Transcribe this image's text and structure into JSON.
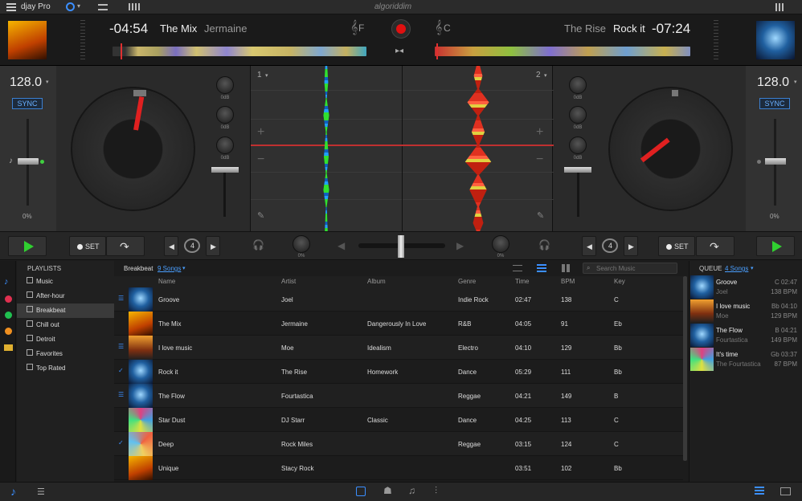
{
  "app": {
    "title": "djay Pro",
    "brand": "algoriddim"
  },
  "deck_left": {
    "time": "-04:54",
    "title": "The Mix",
    "artist": "Jermaine",
    "key": "F",
    "bpm": "128.0",
    "sync": "SYNC",
    "pitch": "0%",
    "num": "1",
    "loop": "4",
    "set": "SET"
  },
  "deck_right": {
    "time": "-07:24",
    "title": "Rock it",
    "artist": "The Rise",
    "key": "C",
    "bpm": "128.0",
    "sync": "SYNC",
    "pitch": "0%",
    "num": "2",
    "loop": "4",
    "set": "SET"
  },
  "eq_labels": {
    "l1": "0dB",
    "l2": "0dB",
    "l3": "0dB",
    "r1": "0dB",
    "r2": "0dB",
    "r3": "0dB",
    "f1": "0%",
    "f2": "0%"
  },
  "sidebar": {
    "header": "PLAYLISTS",
    "items": [
      {
        "label": "Music"
      },
      {
        "label": "After-hour"
      },
      {
        "label": "Breakbeat"
      },
      {
        "label": "Chill out"
      },
      {
        "label": "Detroit"
      },
      {
        "label": "Favorites"
      },
      {
        "label": "Top Rated"
      }
    ]
  },
  "library": {
    "playlist": "Breakbeat",
    "count": "9 Songs",
    "search_placeholder": "Search Music",
    "columns": {
      "name": "Name",
      "artist": "Artist",
      "album": "Album",
      "genre": "Genre",
      "time": "Time",
      "bpm": "BPM",
      "key": "Key"
    },
    "rows": [
      {
        "name": "Groove",
        "artist": "Joel",
        "album": "",
        "genre": "Indie Rock",
        "time": "02:47",
        "bpm": "138",
        "key": "C"
      },
      {
        "name": "The Mix",
        "artist": "Jermaine",
        "album": "Dangerously In Love",
        "genre": "R&B",
        "time": "04:05",
        "bpm": "91",
        "key": "Eb"
      },
      {
        "name": "I love music",
        "artist": "Moe",
        "album": "Idealism",
        "genre": "Electro",
        "time": "04:10",
        "bpm": "129",
        "key": "Bb"
      },
      {
        "name": "Rock it",
        "artist": "The Rise",
        "album": "Homework",
        "genre": "Dance",
        "time": "05:29",
        "bpm": "111",
        "key": "Bb"
      },
      {
        "name": "The Flow",
        "artist": "Fourtastica",
        "album": "",
        "genre": "Reggae",
        "time": "04:21",
        "bpm": "149",
        "key": "B"
      },
      {
        "name": "Star Dust",
        "artist": "DJ Starr",
        "album": "Classic",
        "genre": "Dance",
        "time": "04:25",
        "bpm": "113",
        "key": "C"
      },
      {
        "name": "Deep",
        "artist": "Rock Miles",
        "album": "",
        "genre": "Reggae",
        "time": "03:15",
        "bpm": "124",
        "key": "C"
      },
      {
        "name": "Unique",
        "artist": "Stacy Rock",
        "album": "",
        "genre": "",
        "time": "03:51",
        "bpm": "102",
        "key": "Bb"
      }
    ]
  },
  "queue": {
    "title": "QUEUE",
    "count": "4 Songs",
    "items": [
      {
        "name": "Groove",
        "artist": "Joel",
        "meta1": "C 02:47",
        "meta2": "138 BPM"
      },
      {
        "name": "I love music",
        "artist": "Moe",
        "meta1": "Bb 04:10",
        "meta2": "129 BPM"
      },
      {
        "name": "The Flow",
        "artist": "Fourtastica",
        "meta1": "B 04:21",
        "meta2": "149 BPM"
      },
      {
        "name": "It's time",
        "artist": "The Fourtastica",
        "meta1": "Gb 03:37",
        "meta2": "87 BPM"
      }
    ]
  }
}
